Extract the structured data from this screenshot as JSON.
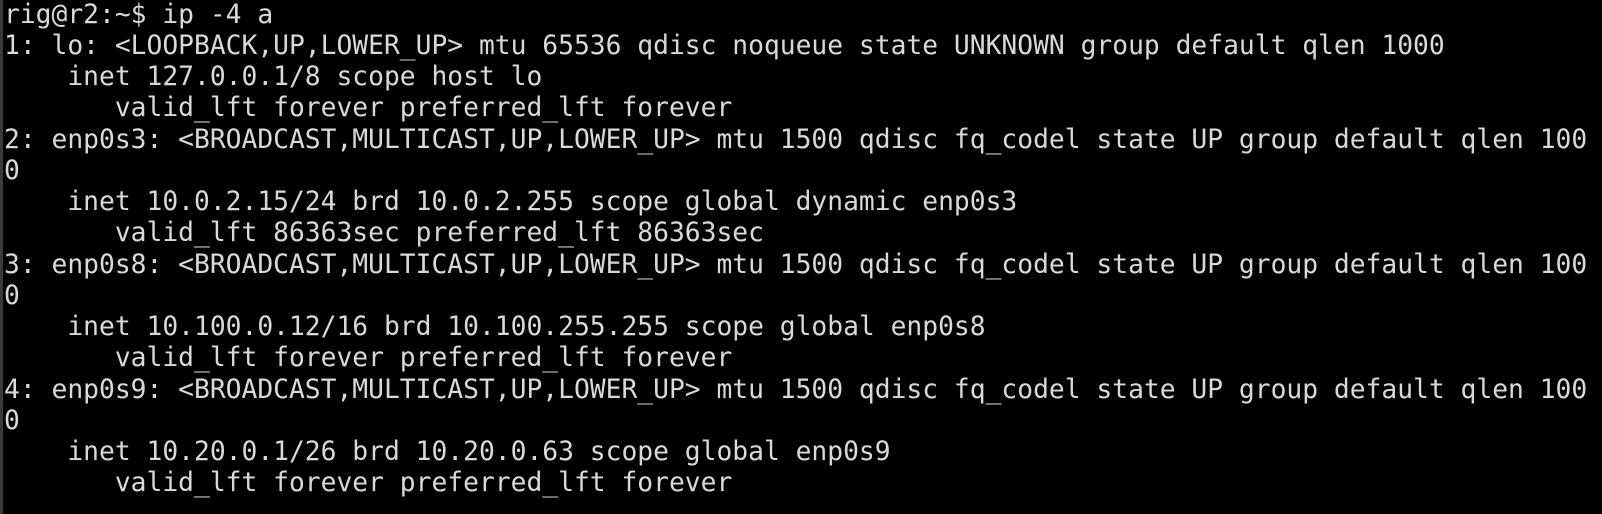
{
  "terminal": {
    "lines": [
      "rig@r2:~$ ip -4 a",
      "1: lo: <LOOPBACK,UP,LOWER_UP> mtu 65536 qdisc noqueue state UNKNOWN group default qlen 1000",
      "    inet 127.0.0.1/8 scope host lo",
      "       valid_lft forever preferred_lft forever",
      "2: enp0s3: <BROADCAST,MULTICAST,UP,LOWER_UP> mtu 1500 qdisc fq_codel state UP group default qlen 100",
      "0",
      "    inet 10.0.2.15/24 brd 10.0.2.255 scope global dynamic enp0s3",
      "       valid_lft 86363sec preferred_lft 86363sec",
      "3: enp0s8: <BROADCAST,MULTICAST,UP,LOWER_UP> mtu 1500 qdisc fq_codel state UP group default qlen 100",
      "0",
      "    inet 10.100.0.12/16 brd 10.100.255.255 scope global enp0s8",
      "       valid_lft forever preferred_lft forever",
      "4: enp0s9: <BROADCAST,MULTICAST,UP,LOWER_UP> mtu 1500 qdisc fq_codel state UP group default qlen 100",
      "0",
      "    inet 10.20.0.1/26 brd 10.20.0.63 scope global enp0s9",
      "       valid_lft forever preferred_lft forever"
    ],
    "colors": {
      "background": "#000000",
      "foreground": "#d9d9d9"
    }
  }
}
